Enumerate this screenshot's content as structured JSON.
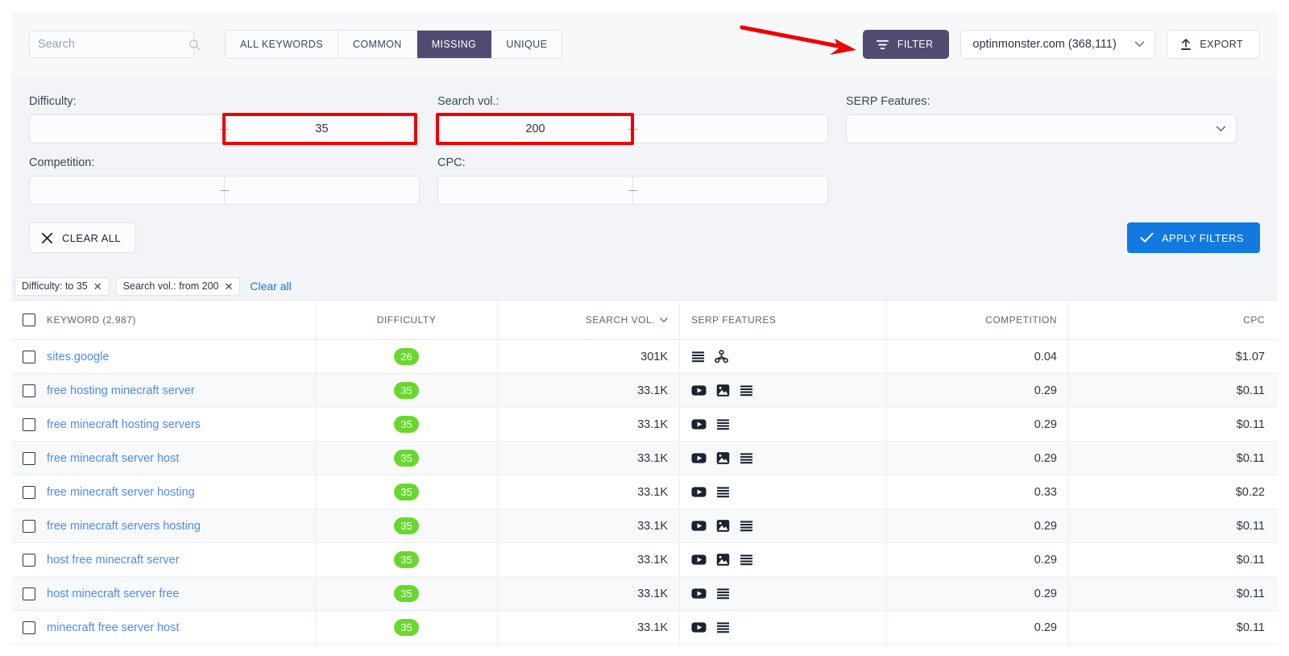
{
  "toolbar": {
    "search": {
      "value": "",
      "placeholder": "Search"
    },
    "segments": [
      {
        "label": "ALL KEYWORDS",
        "active": false
      },
      {
        "label": "COMMON",
        "active": false
      },
      {
        "label": "MISSING",
        "active": true
      },
      {
        "label": "UNIQUE",
        "active": false
      }
    ],
    "filter_label": "FILTER",
    "site_value": "optinmonster.com (368,111)",
    "export_label": "EXPORT"
  },
  "filters": {
    "difficulty": {
      "label": "Difficulty:",
      "from": "",
      "to": "35",
      "highlighted": "to"
    },
    "search_vol": {
      "label": "Search vol.:",
      "from": "200",
      "to": "",
      "highlighted": "from"
    },
    "serp_features": {
      "label": "SERP Features:",
      "value": ""
    },
    "competition": {
      "label": "Competition:",
      "from": "",
      "to": ""
    },
    "cpc": {
      "label": "CPC:",
      "from": "",
      "to": ""
    },
    "clear_all_label": "CLEAR ALL",
    "apply_label": "APPLY FILTERS"
  },
  "chips": {
    "items": [
      {
        "label": "Difficulty: to 35"
      },
      {
        "label": "Search vol.: from 200"
      }
    ],
    "clear_link": "Clear all"
  },
  "table": {
    "columns": [
      {
        "key": "keyword",
        "label": "KEYWORD (2,987)",
        "sortable": false
      },
      {
        "key": "difficulty",
        "label": "DIFFICULTY",
        "sortable": false
      },
      {
        "key": "volume",
        "label": "SEARCH VOL.",
        "sortable": true
      },
      {
        "key": "serp",
        "label": "SERP FEATURES",
        "sortable": false
      },
      {
        "key": "competition",
        "label": "COMPETITION",
        "sortable": false
      },
      {
        "key": "cpc",
        "label": "CPC",
        "sortable": false
      }
    ],
    "rows": [
      {
        "keyword": "sites.google",
        "difficulty": "26",
        "volume": "301K",
        "serp": [
          "sitelinks",
          "related-searches"
        ],
        "competition": "0.04",
        "cpc": "$1.07"
      },
      {
        "keyword": "free hosting minecraft server",
        "difficulty": "35",
        "volume": "33.1K",
        "serp": [
          "video",
          "image",
          "sitelinks"
        ],
        "competition": "0.29",
        "cpc": "$0.11"
      },
      {
        "keyword": "free minecraft hosting servers",
        "difficulty": "35",
        "volume": "33.1K",
        "serp": [
          "video",
          "sitelinks"
        ],
        "competition": "0.29",
        "cpc": "$0.11"
      },
      {
        "keyword": "free minecraft server host",
        "difficulty": "35",
        "volume": "33.1K",
        "serp": [
          "video",
          "image",
          "sitelinks"
        ],
        "competition": "0.29",
        "cpc": "$0.11"
      },
      {
        "keyword": "free minecraft server hosting",
        "difficulty": "35",
        "volume": "33.1K",
        "serp": [
          "video",
          "sitelinks"
        ],
        "competition": "0.33",
        "cpc": "$0.22"
      },
      {
        "keyword": "free minecraft servers hosting",
        "difficulty": "35",
        "volume": "33.1K",
        "serp": [
          "video",
          "image",
          "sitelinks"
        ],
        "competition": "0.29",
        "cpc": "$0.11"
      },
      {
        "keyword": "host free minecraft server",
        "difficulty": "35",
        "volume": "33.1K",
        "serp": [
          "video",
          "image",
          "sitelinks"
        ],
        "competition": "0.29",
        "cpc": "$0.11"
      },
      {
        "keyword": "host minecraft server free",
        "difficulty": "35",
        "volume": "33.1K",
        "serp": [
          "video",
          "sitelinks"
        ],
        "competition": "0.29",
        "cpc": "$0.11"
      },
      {
        "keyword": "minecraft free server host",
        "difficulty": "35",
        "volume": "33.1K",
        "serp": [
          "video",
          "sitelinks"
        ],
        "competition": "0.29",
        "cpc": "$0.11"
      }
    ]
  },
  "colors": {
    "accent_purple": "#514b71",
    "accent_blue": "#1279e0",
    "link_blue": "#4d8cf0",
    "badge_green": "#69d82e",
    "annotation_red": "#ef0000"
  }
}
